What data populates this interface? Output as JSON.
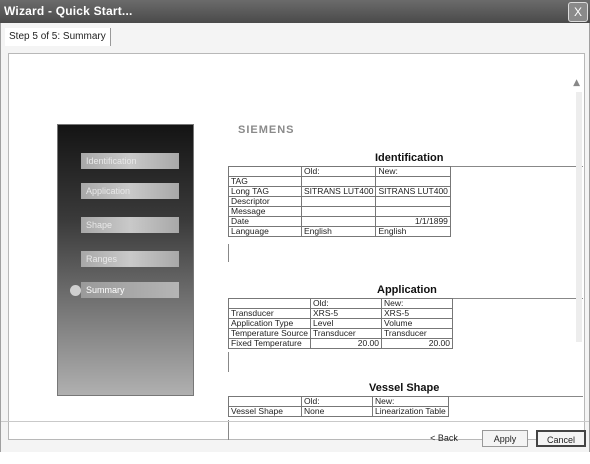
{
  "window": {
    "title": "Wizard - Quick Start...",
    "close_label": "X"
  },
  "step": {
    "label": "Step 5 of 5: Summary"
  },
  "nav": {
    "items": [
      {
        "label": "Identification",
        "active": false
      },
      {
        "label": "Application",
        "active": false
      },
      {
        "label": "Shape",
        "active": false
      },
      {
        "label": "Ranges",
        "active": false
      },
      {
        "label": "Summary",
        "active": true
      }
    ]
  },
  "summary": {
    "brand": "SIEMENS",
    "sections": [
      {
        "title": "Identification",
        "header": [
          "",
          "Old:",
          "New:"
        ],
        "rows": [
          [
            "TAG",
            "",
            ""
          ],
          [
            "Long TAG",
            "SITRANS LUT400",
            "SITRANS LUT400"
          ],
          [
            "Descriptor",
            "",
            ""
          ],
          [
            "Message",
            "",
            ""
          ],
          [
            "Date",
            "",
            "1/1/1899"
          ],
          [
            "Language",
            "English",
            "English"
          ]
        ]
      },
      {
        "title": "Application",
        "header": [
          "",
          "Old:",
          "New:"
        ],
        "rows": [
          [
            "Transducer",
            "XRS-5",
            "XRS-5"
          ],
          [
            "Application Type",
            "Level",
            "Volume"
          ],
          [
            "Temperature Source",
            "Transducer",
            "Transducer"
          ],
          [
            "Fixed Temperature",
            "20.00",
            "20.00"
          ]
        ]
      },
      {
        "title": "Vessel Shape",
        "header": [
          "",
          "Old:",
          "New:"
        ],
        "rows": [
          [
            "Vessel Shape",
            "None",
            "Linearization Table"
          ]
        ]
      }
    ]
  },
  "buttons": {
    "back": "< Back",
    "apply": "Apply",
    "cancel": "Cancel"
  },
  "icons": {
    "scroll_up": "scroll-up-arrow-icon",
    "scroll_down": "scroll-down-arrow-icon"
  }
}
